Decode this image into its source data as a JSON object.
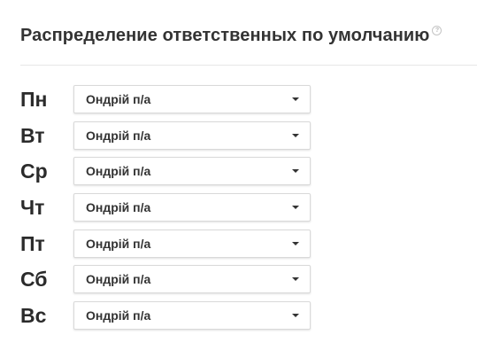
{
  "header": {
    "title": "Распределение ответственных по умолчанию",
    "help_icon": "?"
  },
  "schedule": [
    {
      "day": "Пн",
      "assignee": "Ондрій п/а"
    },
    {
      "day": "Вт",
      "assignee": "Ондрій п/а"
    },
    {
      "day": "Ср",
      "assignee": "Ондрій п/а"
    },
    {
      "day": "Чт",
      "assignee": "Ондрій п/а"
    },
    {
      "day": "Пт",
      "assignee": "Ондрій п/а"
    },
    {
      "day": "Сб",
      "assignee": "Ондрій п/а"
    },
    {
      "day": "Вс",
      "assignee": "Ондрій п/а"
    }
  ]
}
